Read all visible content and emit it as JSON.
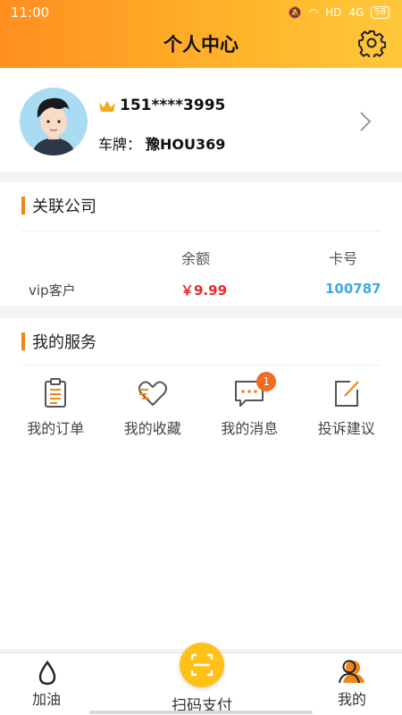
{
  "status": {
    "time": "11:00",
    "network": "HD",
    "signal": "4G",
    "battery": "58"
  },
  "header": {
    "title": "个人中心"
  },
  "profile": {
    "phone": "151****3995",
    "plate_label": "车牌：",
    "plate_value": "豫HOU369"
  },
  "company": {
    "title": "关联公司",
    "columns": {
      "balance": "余额",
      "card": "卡号"
    },
    "row": {
      "customer": "vip客户",
      "balance": "￥9.99",
      "card": "100787"
    }
  },
  "services": {
    "title": "我的服务",
    "items": [
      {
        "label": "我的订单",
        "icon": "clipboard-icon"
      },
      {
        "label": "我的收藏",
        "icon": "heart-icon"
      },
      {
        "label": "我的消息",
        "icon": "message-icon",
        "badge": "1"
      },
      {
        "label": "投诉建议",
        "icon": "edit-icon"
      }
    ]
  },
  "tabbar": {
    "items": [
      {
        "label": "加油",
        "icon": "fuel-drop-icon"
      },
      {
        "label": "扫码支付",
        "icon": "scan-icon"
      },
      {
        "label": "我的",
        "icon": "user-icon"
      }
    ]
  },
  "colors": {
    "accent": "#f08519",
    "header_start": "#ff8f1f",
    "header_end": "#ffc83a",
    "balance": "#e8282b",
    "card": "#3fa9e0",
    "badge": "#f26b21"
  }
}
